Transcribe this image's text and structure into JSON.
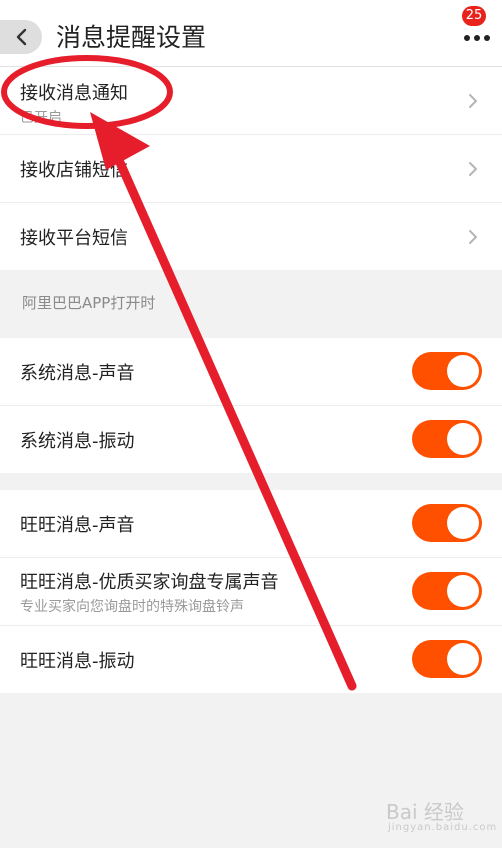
{
  "header": {
    "title": "消息提醒设置",
    "badge_count": "25"
  },
  "group1": {
    "items": [
      {
        "label": "接收消息通知",
        "sub": "已开启"
      },
      {
        "label": "接收店铺短信"
      },
      {
        "label": "接收平台短信"
      }
    ]
  },
  "section": {
    "label": "阿里巴巴APP打开时"
  },
  "group2": {
    "items": [
      {
        "label": "系统消息-声音",
        "enabled": true
      },
      {
        "label": "系统消息-振动",
        "enabled": true
      }
    ]
  },
  "group3": {
    "items": [
      {
        "label": "旺旺消息-声音",
        "enabled": true
      },
      {
        "label": "旺旺消息-优质买家询盘专属声音",
        "sub": "专业买家向您询盘时的特殊询盘铃声",
        "enabled": true
      },
      {
        "label": "旺旺消息-振动",
        "enabled": true
      }
    ]
  },
  "watermark": {
    "text": "Bai 经验",
    "sub": "jingyan.baidu.com"
  },
  "colors": {
    "toggle_on": "#ff5000",
    "badge": "#e8231b",
    "annotation": "#e61e2b"
  },
  "icons": {
    "back": "chevron-left-icon",
    "more": "more-dots-icon",
    "row_arrow": "chevron-right-icon"
  }
}
